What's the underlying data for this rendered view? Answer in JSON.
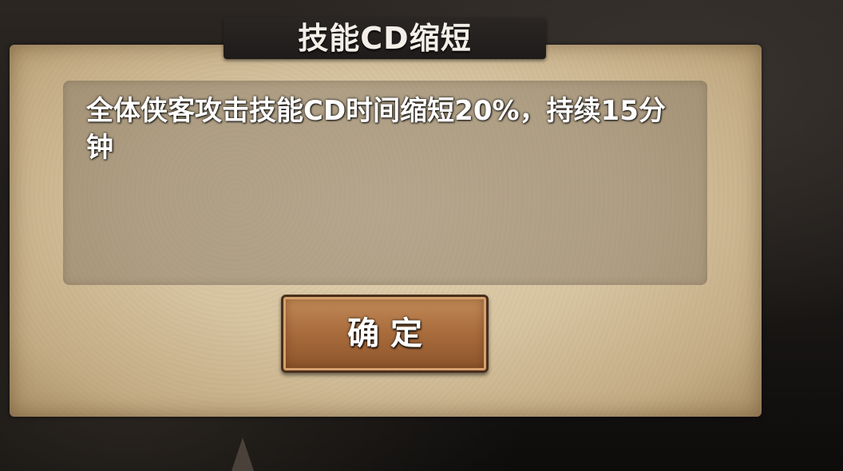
{
  "dialog": {
    "title": "技能CD缩短",
    "description": "全体侠客攻击技能CD时间缩短20%，持续15分钟",
    "confirm_label": "确 定"
  }
}
